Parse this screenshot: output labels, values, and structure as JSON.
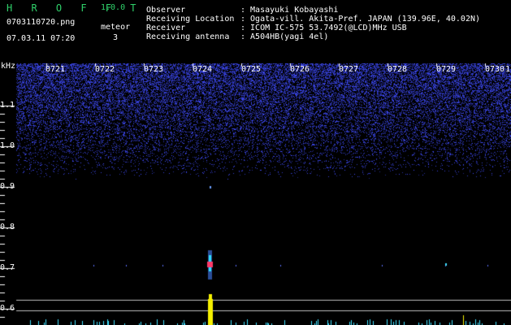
{
  "app": {
    "logo": "H R O F F T",
    "version": "1.0.0"
  },
  "file": {
    "name": "0703110720.png",
    "datetime": "07.03.11 07:20"
  },
  "meteor": {
    "label": "meteor",
    "count": "3"
  },
  "info": {
    "observer_label": "Observer",
    "observer_value": ": Masayuki Kobayashi",
    "location_label": "Receiving Location",
    "location_value": ": Ogata-vill. Akita-Pref. JAPAN (139.96E, 40.02N)",
    "receiver_label": "Receiver",
    "receiver_value": ": ICOM IC-575 53.7492(@LCD)MHz USB",
    "antenna_label": "Receiving antenna",
    "antenna_value": ": A504HB(yagi 4el)"
  },
  "axis": {
    "unit": "kHz",
    "y_ticks": [
      "1.1",
      "1.0",
      "0.9",
      "0.8",
      "0.7",
      "0.6"
    ],
    "x_ticks": [
      "0721",
      "0722",
      "0723",
      "0724",
      "0725",
      "0726",
      "0727",
      "0728",
      "0729",
      "0730"
    ],
    "x_tail": "1"
  },
  "colors": {
    "background": "#000000",
    "noise": "#3a44ff",
    "header_text": "#ffffff",
    "logo": "#2fd06a",
    "meteor_core": "#ff3a6a",
    "signal": "#f5f000",
    "baseline": "#3fe0ff"
  }
}
